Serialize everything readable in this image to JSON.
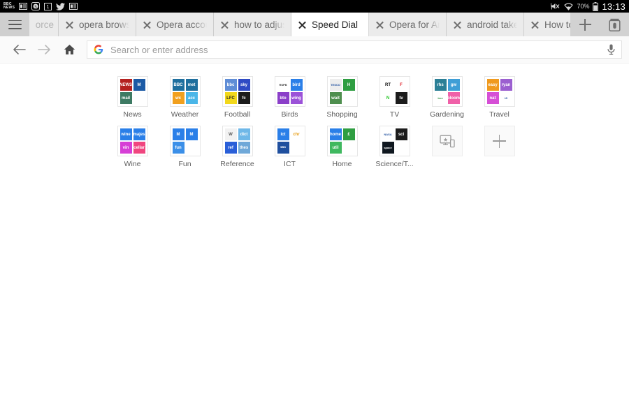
{
  "statusbar": {
    "left_icons": [
      "bbc-news-icon",
      "news-app-icon",
      "dollar-app-icon",
      "one-app-icon",
      "twitter-icon",
      "news-app-icon-2"
    ],
    "bbc_line1": "BBC",
    "bbc_line2": "NEWS",
    "mute_icon": "mute-icon",
    "wifi_icon": "wifi-icon",
    "battery_text": "70%",
    "battery_icon": "battery-icon",
    "time": "13:13"
  },
  "tabstrip": {
    "menu_icon": "hamburger-menu-icon",
    "new_tab_icon": "plus-icon",
    "tab_count_icon": "tab-stack-icon",
    "close_icon": "close-icon",
    "tabs": [
      {
        "title": "orce",
        "active": false,
        "partial": true
      },
      {
        "title": "opera browser",
        "active": false,
        "partial": false
      },
      {
        "title": "Opera account",
        "active": false,
        "partial": false
      },
      {
        "title": "how to adjust",
        "active": false,
        "partial": false
      },
      {
        "title": "Speed Dial",
        "active": true,
        "partial": false
      },
      {
        "title": "Opera for Android",
        "active": false,
        "partial": false
      },
      {
        "title": "android take",
        "active": false,
        "partial": false
      },
      {
        "title": "How to take",
        "active": false,
        "partial": false
      }
    ]
  },
  "addressbar": {
    "back_icon": "back-arrow-icon",
    "forward_icon": "forward-arrow-icon",
    "home_icon": "home-icon",
    "search_engine_icon": "google-g-icon",
    "placeholder": "Search or enter address",
    "value": "",
    "mic_icon": "microphone-icon"
  },
  "speeddial": {
    "row1": [
      {
        "label": "News",
        "tiles": [
          {
            "bg": "#b4201f",
            "text": "NEWS"
          },
          {
            "bg": "#1b5aa5",
            "text": "M"
          },
          {
            "bg": "#3d7a63",
            "text": "mail"
          },
          {
            "bg": "",
            "text": ""
          }
        ]
      },
      {
        "label": "Weather",
        "tiles": [
          {
            "bg": "#1f6f9e",
            "text": "BBC"
          },
          {
            "bg": "#1f6f9e",
            "text": "met"
          },
          {
            "bg": "#f1a01e",
            "text": "wx"
          },
          {
            "bg": "#4ab6e8",
            "text": "acc"
          }
        ]
      },
      {
        "label": "Football",
        "tiles": [
          {
            "bg": "#5f8dd6",
            "text": "bbc"
          },
          {
            "bg": "#2f4bc4",
            "text": "sky"
          },
          {
            "bg": "#f2d81c",
            "text": "LFC"
          },
          {
            "bg": "#1c1c1c",
            "text": "fc"
          }
        ]
      },
      {
        "label": "Birds",
        "tiles": [
          {
            "bg": "#ffffff",
            "text": "RSPB"
          },
          {
            "bg": "#2a7fe8",
            "text": "bird"
          },
          {
            "bg": "#8b3fc9",
            "text": "bto"
          },
          {
            "bg": "#9b52d8",
            "text": "wing"
          }
        ]
      },
      {
        "label": "Shopping",
        "tiles": [
          {
            "bg": "#ededed",
            "text": "TESCO"
          },
          {
            "bg": "#2f9e42",
            "text": "H"
          },
          {
            "bg": "#4f8f4f",
            "text": "wait"
          },
          {
            "bg": "",
            "text": ""
          }
        ]
      },
      {
        "label": "TV",
        "tiles": [
          {
            "bg": "#ffffff",
            "text": "RT"
          },
          {
            "bg": "#ffffff",
            "text": "F"
          },
          {
            "bg": "#ffffff",
            "text": "N"
          },
          {
            "bg": "#1c1c1c",
            "text": "tv"
          }
        ]
      },
      {
        "label": "Gardening",
        "tiles": [
          {
            "bg": "#2b7f96",
            "text": "rhs"
          },
          {
            "bg": "#3f9ed6",
            "text": "gw"
          },
          {
            "bg": "#ffffff",
            "text": "tree"
          },
          {
            "bg": "#f060a8",
            "text": "bloom"
          }
        ]
      },
      {
        "label": "Travel",
        "tiles": [
          {
            "bg": "#f09a1e",
            "text": "easy"
          },
          {
            "bg": "#9b5fd0",
            "text": "ryan"
          },
          {
            "bg": "#d64fd6",
            "text": "nat"
          },
          {
            "bg": "#ffffff",
            "text": "tfl"
          }
        ]
      }
    ],
    "row2": [
      {
        "label": "Wine",
        "tiles": [
          {
            "bg": "#2a7fe8",
            "text": "wine"
          },
          {
            "bg": "#2a7fe8",
            "text": "majes"
          },
          {
            "bg": "#d63fd6",
            "text": "vin"
          },
          {
            "bg": "#f0467f",
            "text": "cellar"
          }
        ]
      },
      {
        "label": "Fun",
        "tiles": [
          {
            "bg": "#2a7fe8",
            "text": "M"
          },
          {
            "bg": "#2a7fe8",
            "text": "M"
          },
          {
            "bg": "#3b8fe8",
            "text": "fun"
          },
          {
            "bg": "",
            "text": ""
          }
        ]
      },
      {
        "label": "Reference",
        "tiles": [
          {
            "bg": "#f2f2f2",
            "text": "W"
          },
          {
            "bg": "#6fb8e8",
            "text": "dict"
          },
          {
            "bg": "#2a5fd8",
            "text": "ref"
          },
          {
            "bg": "#6fa8d8",
            "text": "thes"
          }
        ]
      },
      {
        "label": "ICT",
        "tiles": [
          {
            "bg": "#2a7fe8",
            "text": "ict"
          },
          {
            "bg": "#ffffff",
            "text": "chr"
          },
          {
            "bg": "#1f4f9e",
            "text": "1&1"
          },
          {
            "bg": "",
            "text": ""
          }
        ]
      },
      {
        "label": "Home",
        "tiles": [
          {
            "bg": "#2a7fe8",
            "text": "home"
          },
          {
            "bg": "#2f9e42",
            "text": "£"
          },
          {
            "bg": "#3fb85f",
            "text": "util"
          },
          {
            "bg": "",
            "text": ""
          }
        ]
      },
      {
        "label": "Science/T...",
        "tiles": [
          {
            "bg": "#ffffff",
            "text": "NASA"
          },
          {
            "bg": "#1c1c1c",
            "text": "sci"
          },
          {
            "bg": "#101820",
            "text": "space"
          },
          {
            "bg": "",
            "text": ""
          }
        ]
      },
      {
        "label": "",
        "action": "sync-devices",
        "icon": "sync-devices-icon"
      },
      {
        "label": "",
        "action": "add-speed-dial",
        "icon": "plus-icon"
      }
    ]
  }
}
